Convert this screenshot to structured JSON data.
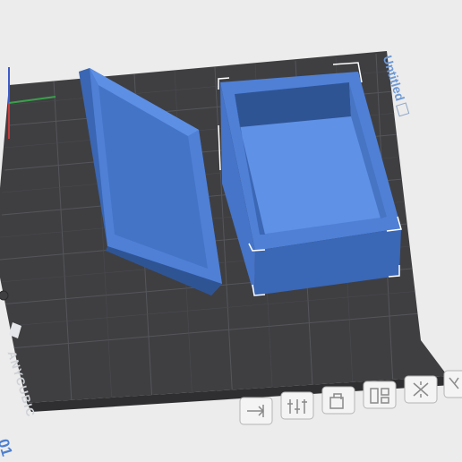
{
  "plate": {
    "name": "Untitled",
    "number": "01",
    "brand": "ANYCUBIC"
  },
  "colors": {
    "background": "#ececec",
    "plate": "#3f3f42",
    "model": "#4d7ed4",
    "accent": "#4d7fcf"
  },
  "toolbar": {
    "items": [
      {
        "icon": "arrange-icon"
      },
      {
        "icon": "orient-icon"
      },
      {
        "icon": "lock-icon"
      },
      {
        "icon": "layout-icon"
      },
      {
        "icon": "auto-support-icon"
      },
      {
        "icon": "cut-icon"
      }
    ]
  },
  "axes": [
    "x-axis",
    "y-axis",
    "z-axis"
  ]
}
